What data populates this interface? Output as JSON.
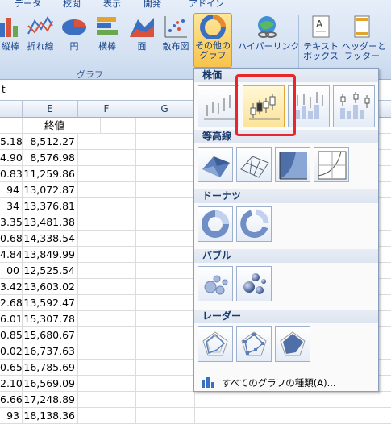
{
  "ribbon": {
    "tabs": [
      "データ",
      "校閲",
      "表示",
      "開発",
      "アドイン"
    ],
    "buttons": [
      {
        "label": "縦棒",
        "icon": "column-chart-icon"
      },
      {
        "label": "折れ線",
        "icon": "line-chart-icon"
      },
      {
        "label": "円",
        "icon": "pie-chart-icon"
      },
      {
        "label": "横棒",
        "icon": "bar-chart-icon"
      },
      {
        "label": "面",
        "icon": "area-chart-icon"
      },
      {
        "label": "散布図",
        "icon": "scatter-chart-icon"
      },
      {
        "label": "その他の",
        "label2": "グラフ",
        "icon": "other-charts-icon"
      },
      {
        "label": "ハイパーリンク",
        "icon": "hyperlink-icon"
      },
      {
        "label": "テキスト",
        "label2": "ボックス",
        "icon": "textbox-icon"
      },
      {
        "label": "ヘッダーと",
        "label2": "フッター",
        "icon": "header-footer-icon"
      }
    ],
    "group_label": "グラフ"
  },
  "formula_bar": {
    "value": "t"
  },
  "sheet": {
    "columns": [
      "E",
      "F",
      "G"
    ],
    "header_row": {
      "d": "",
      "e": "終値"
    },
    "rows": [
      {
        "d": "5.18",
        "e": "8,512.27"
      },
      {
        "d": "4.90",
        "e": "8,576.98"
      },
      {
        "d": "0.83",
        "e": "11,259.86"
      },
      {
        "d": "94",
        "e": "13,072.87"
      },
      {
        "d": "34",
        "e": "13,376.81"
      },
      {
        "d": "3.35",
        "e": "13,481.38"
      },
      {
        "d": "0.68",
        "e": "14,338.54"
      },
      {
        "d": "4.84",
        "e": "13,849.99"
      },
      {
        "d": "00",
        "e": "12,525.54"
      },
      {
        "d": "3.42",
        "e": "13,603.02"
      },
      {
        "d": "2.68",
        "e": "13,592.47"
      },
      {
        "d": "6.01",
        "e": "15,307.78"
      },
      {
        "d": "0.85",
        "e": "15,680.67"
      },
      {
        "d": "0.02",
        "e": "16,737.63"
      },
      {
        "d": "0.65",
        "e": "16,785.69"
      },
      {
        "d": "2.10",
        "e": "16,569.09"
      },
      {
        "d": "6.66",
        "e": "17,248.89"
      },
      {
        "d": "93",
        "e": "18,138.36"
      }
    ]
  },
  "dropdown": {
    "sections": [
      {
        "title": "株価",
        "icons": [
          "stock-hlc-icon",
          "stock-ohlc-icon",
          "stock-vhlc-icon",
          "stock-vohlc-icon"
        ]
      },
      {
        "title": "等高線",
        "icons": [
          "surface-3d-icon",
          "wireframe-surface-icon",
          "contour-icon",
          "wireframe-contour-icon"
        ]
      },
      {
        "title": "ドーナツ",
        "icons": [
          "doughnut-icon",
          "exploded-doughnut-icon"
        ]
      },
      {
        "title": "バブル",
        "icons": [
          "bubble-icon",
          "bubble-3d-icon"
        ]
      },
      {
        "title": "レーダー",
        "icons": [
          "radar-icon",
          "radar-markers-icon",
          "filled-radar-icon"
        ]
      }
    ],
    "footer_label": "すべてのグラフの種類(A)...",
    "selected": "stock-ohlc-icon"
  }
}
